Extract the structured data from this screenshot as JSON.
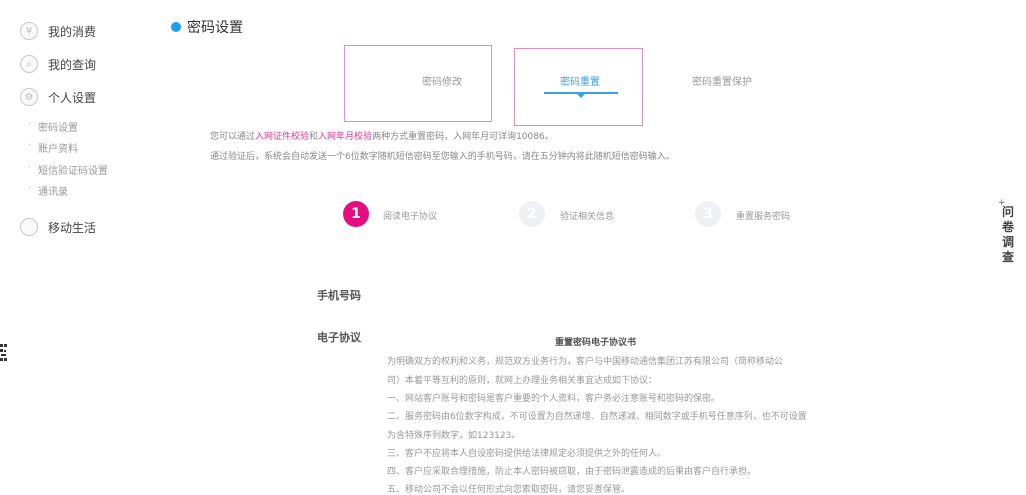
{
  "sidebar": {
    "items": [
      {
        "label": "我的消费",
        "icon": "wallet-icon"
      },
      {
        "label": "我的查询",
        "icon": "search-icon"
      },
      {
        "label": "个人设置",
        "icon": "settings-icon"
      },
      {
        "label": "移动生活",
        "icon": "life-icon"
      }
    ],
    "subitems": [
      "密码设置",
      "账户资料",
      "短信验证码设置",
      "通讯录"
    ]
  },
  "header": {
    "title": "密码设置"
  },
  "tabs": [
    {
      "label": "密码修改"
    },
    {
      "label": "密码重置"
    },
    {
      "label": "密码重置保护"
    }
  ],
  "notes": {
    "line1_prefix": "您可以通过",
    "line1_link1": "入网证件校验",
    "line1_mid": "和",
    "line1_link2": "入网年月校验",
    "line1_suffix": "两种方式重置密码，入网年月可详询10086。",
    "line2": "通过验证后，系统会自动发送一个6位数字随机短信密码至您输入的手机号码，请在五分钟内将此随机短信密码输入。"
  },
  "steps": [
    {
      "num": "1",
      "label": "阅读电子协议"
    },
    {
      "num": "2",
      "label": "验证相关信息"
    },
    {
      "num": "3",
      "label": "重置服务密码"
    }
  ],
  "form": {
    "phone_label": "手机号码",
    "agreement_label": "电子协议"
  },
  "agreement": {
    "title": "重置密码电子协议书",
    "lines": [
      "为明确双方的权利和义务，规范双方业务行为，客户与中国移动通信集团江苏有限公司（简称移动公",
      "司）本着平等互利的原则，就网上办理业务相关事宜达成如下协议：",
      "一、网站客户账号和密码是客户重要的个人资料，客户务必注意账号和密码的保密。",
      "二、服务密码由6位数字构成，不可设置为自然递增、自然递减、相同数字或手机号任意序列，也不可设置",
      "为含特殊序列数字，如123123。",
      "三、客户不应将本人自设密码提供给法律规定必须提供之外的任何人。",
      "四、客户应采取合理措施，防止本人密码被窃取，由于密码泄露造成的后果由客户自行承担。",
      "五、移动公司不会以任何形式向您索取密码，请您妥善保管。"
    ]
  },
  "float": {
    "label": "问卷调查",
    "plus": "+"
  },
  "colors": {
    "accent": "#1a9ff2",
    "brand": "#e40e7f",
    "tab_border": "#e58ac4"
  }
}
